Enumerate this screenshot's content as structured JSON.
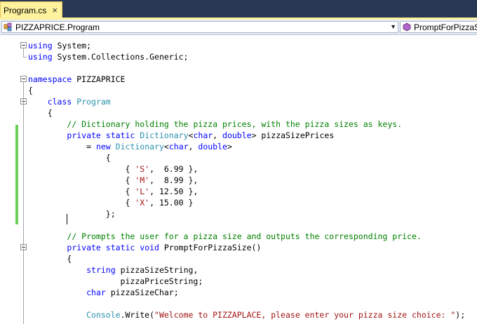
{
  "tab": {
    "title": "Program.cs",
    "close_icon": "×"
  },
  "navbar": {
    "left_label": "PIZZAPRICE.Program",
    "right_label": "PromptForPizzaSi"
  },
  "colors": {
    "keyword": "#0000ff",
    "type": "#2b91af",
    "string": "#a31515",
    "comment": "#008000",
    "tab_active": "#fff29d",
    "tabstrip": "#293955",
    "change_bar": "#6ccf5a"
  },
  "code_lines": [
    [
      [
        "kw",
        "using"
      ],
      [
        "pl",
        " System;"
      ]
    ],
    [
      [
        "kw",
        "using"
      ],
      [
        "pl",
        " System.Collections.Generic;"
      ]
    ],
    [],
    [
      [
        "kw",
        "namespace"
      ],
      [
        "pl",
        " PIZZAPRICE"
      ]
    ],
    [
      [
        "pl",
        "{"
      ]
    ],
    [
      [
        "pl",
        "    "
      ],
      [
        "kw",
        "class"
      ],
      [
        "pl",
        " "
      ],
      [
        "ty",
        "Program"
      ]
    ],
    [
      [
        "pl",
        "    {"
      ]
    ],
    [
      [
        "pl",
        "        "
      ],
      [
        "cm",
        "// Dictionary holding the pizza prices, with the pizza sizes as keys."
      ]
    ],
    [
      [
        "pl",
        "        "
      ],
      [
        "kw",
        "private"
      ],
      [
        "pl",
        " "
      ],
      [
        "kw",
        "static"
      ],
      [
        "pl",
        " "
      ],
      [
        "ty",
        "Dictionary"
      ],
      [
        "pl",
        "<"
      ],
      [
        "kw",
        "char"
      ],
      [
        "pl",
        ", "
      ],
      [
        "kw",
        "double"
      ],
      [
        "pl",
        "> pizzaSizePrices"
      ]
    ],
    [
      [
        "pl",
        "            = "
      ],
      [
        "kw",
        "new"
      ],
      [
        "pl",
        " "
      ],
      [
        "ty",
        "Dictionary"
      ],
      [
        "pl",
        "<"
      ],
      [
        "kw",
        "char"
      ],
      [
        "pl",
        ", "
      ],
      [
        "kw",
        "double"
      ],
      [
        "pl",
        ">"
      ]
    ],
    [
      [
        "pl",
        "                {"
      ]
    ],
    [
      [
        "pl",
        "                    { "
      ],
      [
        "str",
        "'S'"
      ],
      [
        "pl",
        ",  6.99 },"
      ]
    ],
    [
      [
        "pl",
        "                    { "
      ],
      [
        "str",
        "'M'"
      ],
      [
        "pl",
        ",  8.99 },"
      ]
    ],
    [
      [
        "pl",
        "                    { "
      ],
      [
        "str",
        "'L'"
      ],
      [
        "pl",
        ", 12.50 },"
      ]
    ],
    [
      [
        "pl",
        "                    { "
      ],
      [
        "str",
        "'X'"
      ],
      [
        "pl",
        ", 15.00 }"
      ]
    ],
    [
      [
        "pl",
        "                };"
      ]
    ],
    [],
    [
      [
        "pl",
        "        "
      ],
      [
        "cm",
        "// Prompts the user for a pizza size and outputs the corresponding price."
      ]
    ],
    [
      [
        "pl",
        "        "
      ],
      [
        "kw",
        "private"
      ],
      [
        "pl",
        " "
      ],
      [
        "kw",
        "static"
      ],
      [
        "pl",
        " "
      ],
      [
        "kw",
        "void"
      ],
      [
        "pl",
        " PromptForPizzaSize()"
      ]
    ],
    [
      [
        "pl",
        "        {"
      ]
    ],
    [
      [
        "pl",
        "            "
      ],
      [
        "kw",
        "string"
      ],
      [
        "pl",
        " pizzaSizeString,"
      ]
    ],
    [
      [
        "pl",
        "                   pizzaPriceString;"
      ]
    ],
    [
      [
        "pl",
        "            "
      ],
      [
        "kw",
        "char"
      ],
      [
        "pl",
        " pizzaSizeChar;"
      ]
    ],
    [],
    [
      [
        "pl",
        "            "
      ],
      [
        "ty",
        "Console"
      ],
      [
        "pl",
        ".Write("
      ],
      [
        "str",
        "\"Welcome to PIZZAPLACE, please enter your pizza size choice: \""
      ],
      [
        "pl",
        ");"
      ]
    ]
  ]
}
